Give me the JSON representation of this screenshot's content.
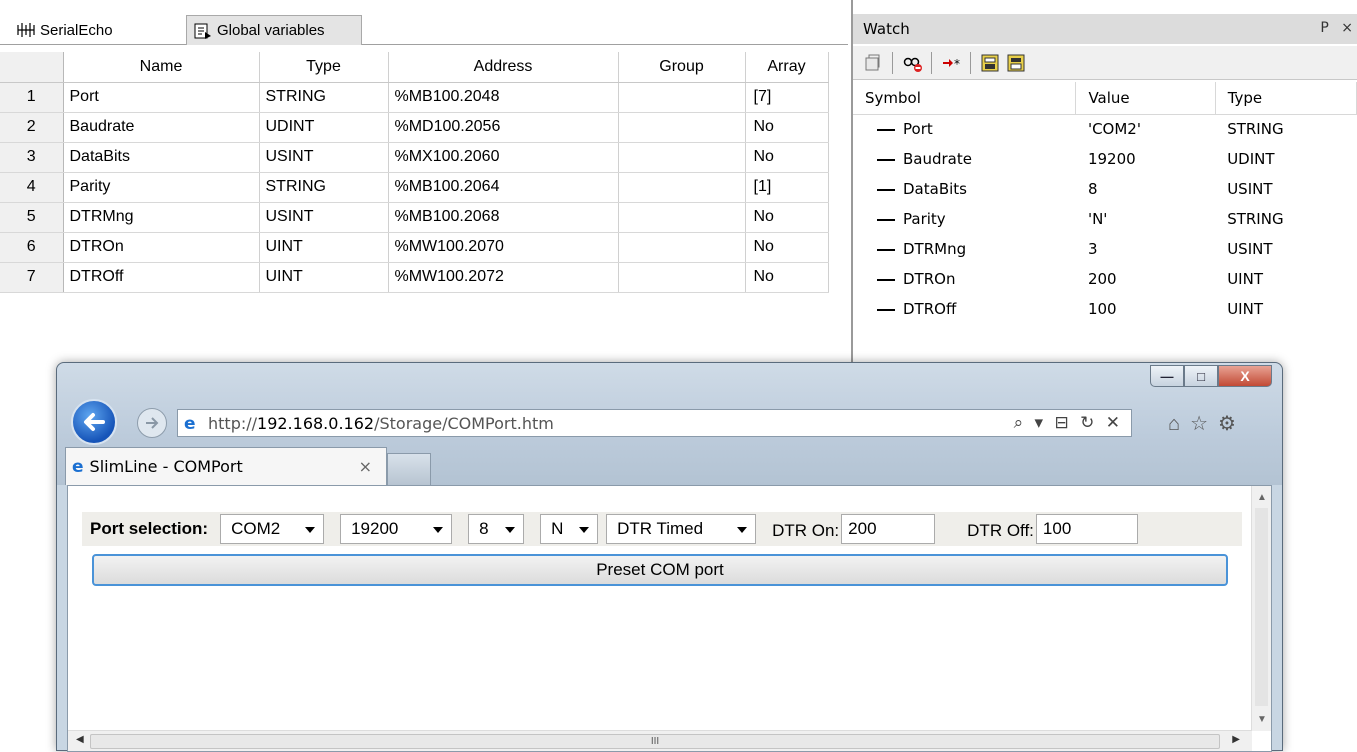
{
  "ide": {
    "tabs": [
      {
        "label": "SerialEcho",
        "icon": "serial-icon"
      },
      {
        "label": "Global variables",
        "icon": "global-variables-icon"
      }
    ],
    "columns": [
      "",
      "Name",
      "Type",
      "Address",
      "Group",
      "Array"
    ],
    "rows": [
      {
        "num": "1",
        "name": "Port",
        "type": "STRING",
        "address": "%MB100.2048",
        "group": "",
        "array": "[7]"
      },
      {
        "num": "2",
        "name": "Baudrate",
        "type": "UDINT",
        "address": "%MD100.2056",
        "group": "",
        "array": "No"
      },
      {
        "num": "3",
        "name": "DataBits",
        "type": "USINT",
        "address": "%MX100.2060",
        "group": "",
        "array": "No"
      },
      {
        "num": "4",
        "name": "Parity",
        "type": "STRING",
        "address": "%MB100.2064",
        "group": "",
        "array": "[1]"
      },
      {
        "num": "5",
        "name": "DTRMng",
        "type": "USINT",
        "address": "%MB100.2068",
        "group": "",
        "array": "No"
      },
      {
        "num": "6",
        "name": "DTROn",
        "type": "UINT",
        "address": "%MW100.2070",
        "group": "",
        "array": "No"
      },
      {
        "num": "7",
        "name": "DTROff",
        "type": "UINT",
        "address": "%MW100.2072",
        "group": "",
        "array": "No"
      }
    ]
  },
  "watch": {
    "title": "Watch",
    "pin_glyph": "Ρ",
    "close_glyph": "×",
    "toolbar_icons": [
      "properties-icon",
      "watch-remove-icon",
      "add-symbol-icon",
      "import-icon",
      "export-icon"
    ],
    "columns": [
      "Symbol",
      "Value",
      "Type"
    ],
    "rows": [
      {
        "symbol": "Port",
        "value": "'COM2'",
        "type": "STRING"
      },
      {
        "symbol": "Baudrate",
        "value": "19200",
        "type": "UDINT"
      },
      {
        "symbol": "DataBits",
        "value": "8",
        "type": "USINT"
      },
      {
        "symbol": "Parity",
        "value": "'N'",
        "type": "STRING"
      },
      {
        "symbol": "DTRMng",
        "value": "3",
        "type": "USINT"
      },
      {
        "symbol": "DTROn",
        "value": "200",
        "type": "UINT"
      },
      {
        "symbol": "DTROff",
        "value": "100",
        "type": "UINT"
      }
    ]
  },
  "browser": {
    "url_prefix": "http://",
    "url_host": "192.168.0.162",
    "url_path": "/Storage/COMPort.htm",
    "addr_icons": "⌕ ▾ ⊟ ↻ ✕",
    "toolbar_icons": "⌂☆⚙",
    "tab_title": "SlimLine - COMPort",
    "tab_close": "×",
    "window_buttons": {
      "minimize": "—",
      "maximize": "□",
      "close": "X"
    },
    "form": {
      "port_label": "Port selection:",
      "port": "COM2",
      "baud": "19200",
      "databits": "8",
      "parity": "N",
      "dtr_mode": "DTR Timed",
      "dtr_on_label": "DTR On:",
      "dtr_on": "200",
      "dtr_off_label": "DTR Off:",
      "dtr_off": "100",
      "preset_button": "Preset COM port"
    },
    "hscroll_grip": "III"
  },
  "colors": {
    "accent": "#4a93d8",
    "ie_blue": "#1a6fd1",
    "window_frame": "#c8d6e3",
    "close_red": "#c24a35"
  }
}
